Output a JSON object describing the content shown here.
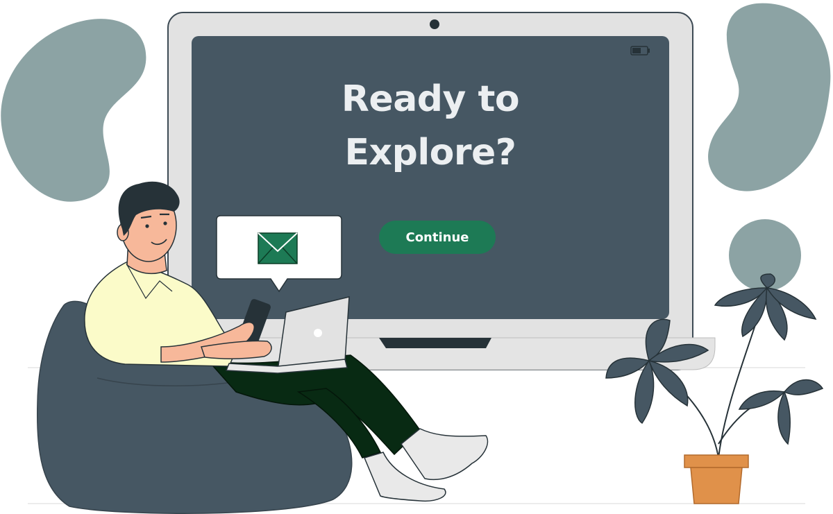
{
  "screen": {
    "title_line1": "Ready to",
    "title_line2": "Explore?"
  },
  "actions": {
    "continue_label": "Continue"
  },
  "icons": {
    "camera": "webcam-icon",
    "battery": "battery-icon",
    "message": "envelope-icon",
    "laptop_logo": "apple-logo-icon"
  },
  "colors": {
    "screen_bg": "#465763",
    "monitor_frame": "#e2e2e2",
    "accent_button": "#1d7a55",
    "blob": "#8ca3a4",
    "envelope": "#1d7a55",
    "shirt": "#fbfbc9",
    "pants": "#082a13",
    "pot": "#e0914a"
  }
}
